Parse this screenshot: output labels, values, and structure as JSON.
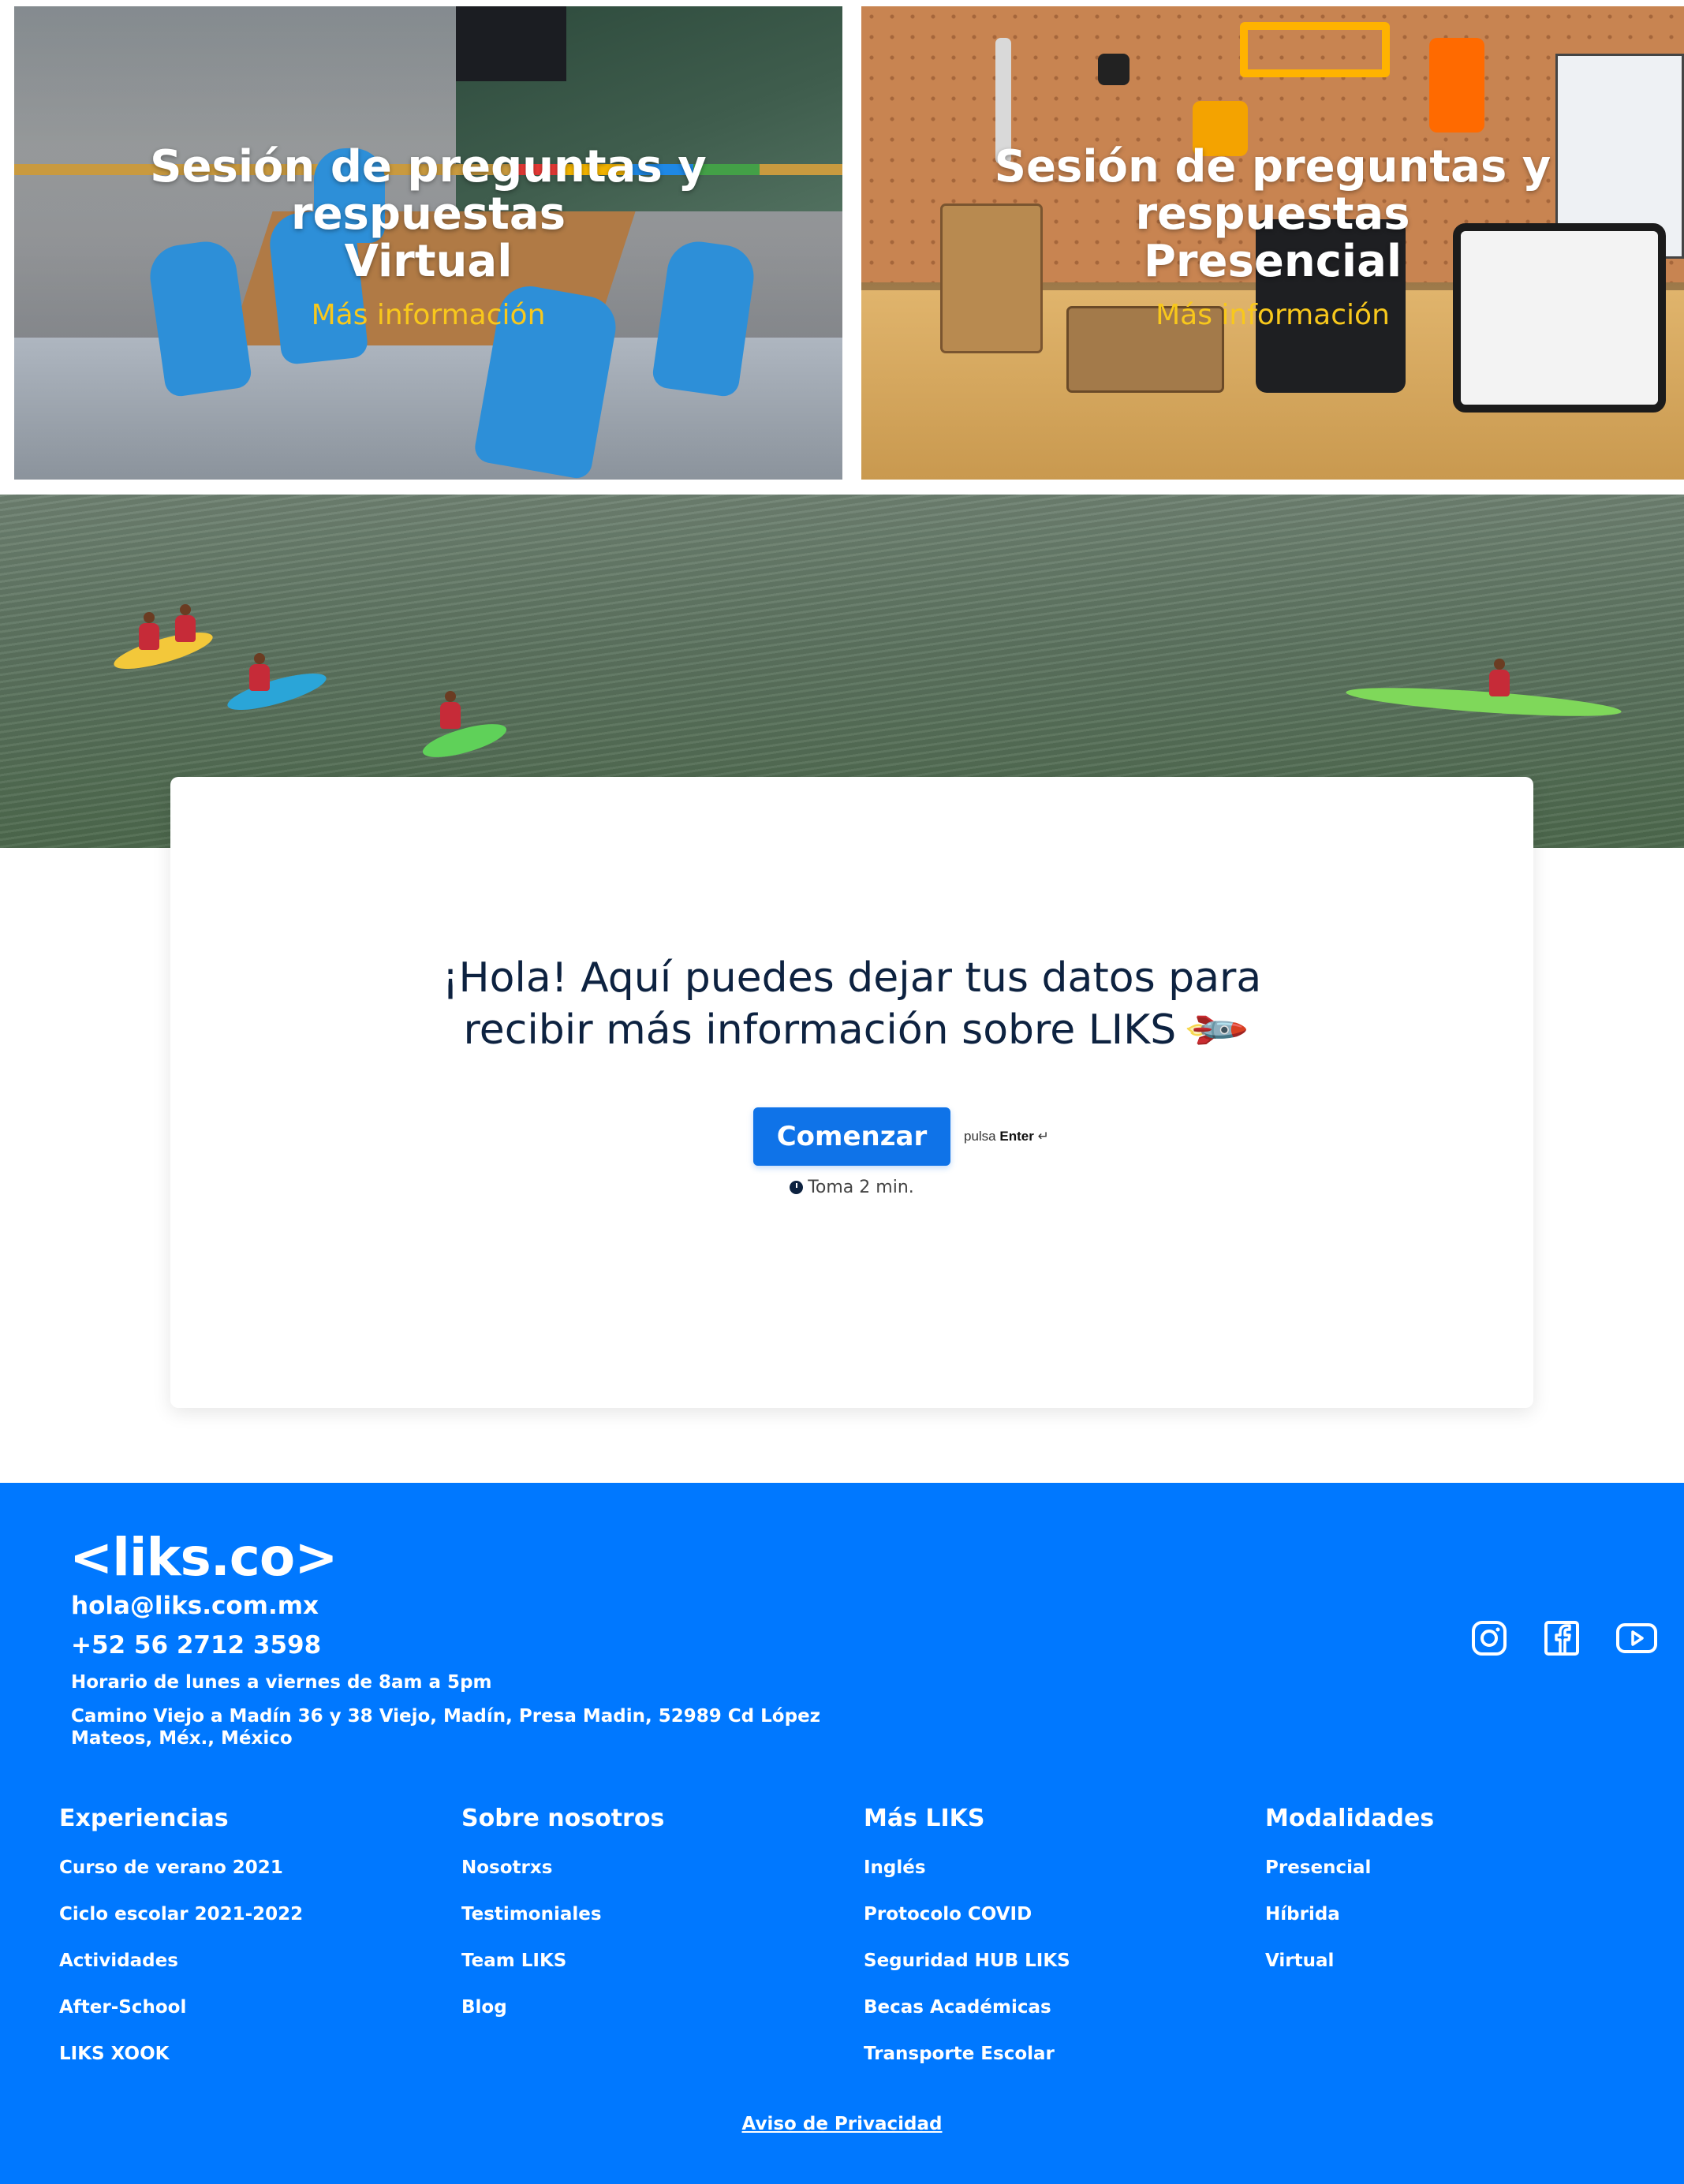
{
  "cards": [
    {
      "title_line1": "Sesión de preguntas y",
      "title_line2": "respuestas",
      "title_line3": "Virtual",
      "link": "Más información"
    },
    {
      "title_line1": "Sesión de preguntas y",
      "title_line2": "respuestas",
      "title_line3": "Presencial",
      "link": "Más información"
    }
  ],
  "form": {
    "heading_line1": "¡Hola! Aquí puedes dejar tus datos para",
    "heading_line2": "recibir más información sobre LIKS",
    "heading_emoji": "rocket-icon",
    "start_label": "Comenzar",
    "enter_prefix": "pulsa",
    "enter_key": "Enter",
    "enter_symbol": "↵",
    "time_hint": "Toma 2 min."
  },
  "footer": {
    "logo": "<liks.co>",
    "email": "hola@liks.com.mx",
    "phone": "+52 56 2712 3598",
    "hours": "Horario de lunes a viernes de 8am a 5pm",
    "address": "Camino Viejo a Madín 36 y 38 Viejo, Madín, Presa Madin, 52989 Cd López Mateos, Méx., México",
    "social": [
      "instagram-icon",
      "facebook-icon",
      "youtube-icon"
    ],
    "columns": [
      {
        "title": "Experiencias",
        "links": [
          "Curso de verano 2021",
          "Ciclo escolar 2021-2022",
          "Actividades",
          "After-School",
          "LIKS XOOK"
        ]
      },
      {
        "title": "Sobre nosotros",
        "links": [
          "Nosotrxs",
          "Testimoniales",
          "Team LIKS",
          "Blog"
        ]
      },
      {
        "title": "Más LIKS",
        "links": [
          "Inglés",
          "Protocolo COVID",
          "Seguridad HUB LIKS",
          "Becas Académicas",
          "Transporte Escolar"
        ]
      },
      {
        "title": "Modalidades",
        "links": [
          "Presencial",
          "Híbrida",
          "Virtual"
        ]
      }
    ],
    "privacy": "Aviso de Privacidad"
  },
  "colors": {
    "brand_blue": "#0078ff",
    "button_blue": "#0f73e8",
    "link_yellow": "#f8c81c",
    "heading_navy": "#0d2240"
  }
}
